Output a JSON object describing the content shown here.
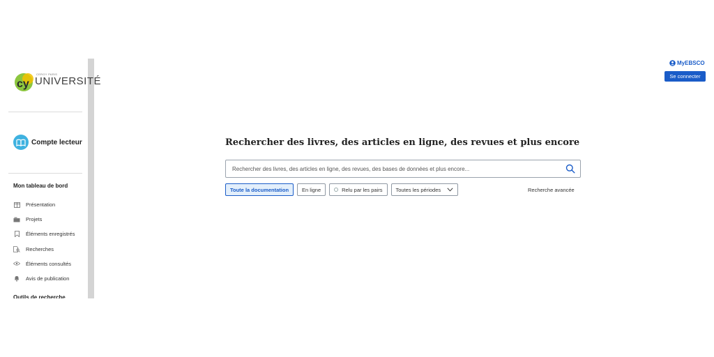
{
  "header": {
    "account_link": "MyEBSCO",
    "login_button": "Se connecter"
  },
  "sidebar": {
    "logo": {
      "small_text": "CERGY PARIS",
      "brand": "UNIVERSITÉ"
    },
    "account_label": "Compte lecteur",
    "dashboard_title": "Mon tableau de bord",
    "items": [
      {
        "label": "Présentation",
        "icon": "columns-icon"
      },
      {
        "label": "Projets",
        "icon": "folders-icon"
      },
      {
        "label": "Éléments enregistrés",
        "icon": "bookmark-icon"
      },
      {
        "label": "Recherches",
        "icon": "search-history-icon"
      },
      {
        "label": "Éléments consultés",
        "icon": "eye-icon"
      },
      {
        "label": "Avis de publication",
        "icon": "bell-icon"
      }
    ],
    "tools_title": "Outils de recherche"
  },
  "main": {
    "heading": "Rechercher des livres, des articles en ligne, des revues et plus encore",
    "search": {
      "placeholder": "Rechercher des livres, des articles en ligne, des revues, des bases de données et plus encore...",
      "value": ""
    },
    "filters": {
      "all_docs": "Toute la documentation",
      "online": "En ligne",
      "peer_reviewed": "Relu par les pairs",
      "all_periods": "Toutes les périodes"
    },
    "advanced_search": "Recherche avancée"
  },
  "colors": {
    "accent": "#1a5cc8",
    "logo_green": "#8cc63f",
    "account_icon": "#3fb2e0"
  }
}
